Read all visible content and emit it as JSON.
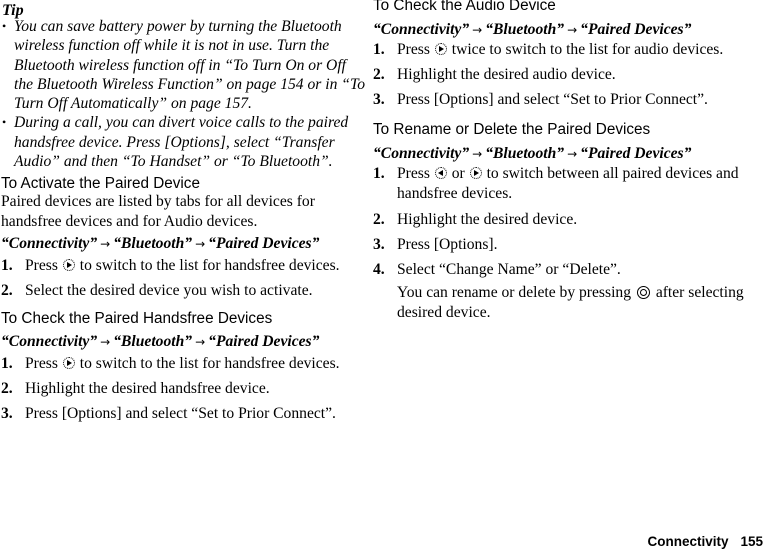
{
  "tip": {
    "title": "Tip",
    "bullet": "•",
    "items": [
      "You can save battery power by turning the Bluetooth wireless function off while it is not in use. Turn the Bluetooth wireless function off in “To Turn On or Off the Bluetooth Wireless Function” on page 154 or in “To Turn Off Automatically” on page 157.",
      "During a call, you can divert voice calls to the paired handsfree device. Press [Options], select “Transfer Audio” and then “To Handset” or “To Bluetooth”."
    ]
  },
  "path": {
    "part1": "“Connectivity”",
    "part2": "“Bluetooth”",
    "part3": "“Paired Devices”",
    "arrow": "→"
  },
  "sections": {
    "activate": {
      "heading": "To Activate the Paired Device",
      "intro": "Paired devices are listed by tabs for all devices for handsfree devices and for Audio devices.",
      "steps": [
        {
          "num": "1.",
          "pre": "Press",
          "post": "to switch to the list for handsfree devices."
        },
        {
          "num": "2.",
          "text": "Select the desired device you wish to activate."
        }
      ]
    },
    "check_handsfree": {
      "heading": "To Check the Paired Handsfree Devices",
      "steps": [
        {
          "num": "1.",
          "pre": "Press",
          "post": "to switch to the list for handsfree devices."
        },
        {
          "num": "2.",
          "text": "Highlight the desired handsfree device."
        },
        {
          "num": "3.",
          "text": "Press [Options] and select “Set to Prior Connect”."
        }
      ]
    },
    "check_audio": {
      "heading": "To Check the Audio Device",
      "steps": [
        {
          "num": "1.",
          "pre": "Press",
          "post": "twice to switch to the list for audio devices."
        },
        {
          "num": "2.",
          "text": "Highlight the desired audio device."
        },
        {
          "num": "3.",
          "text": "Press [Options] and select “Set to Prior Connect”."
        }
      ]
    },
    "rename_delete": {
      "heading": "To Rename or Delete the Paired Devices",
      "steps": [
        {
          "num": "1.",
          "pre": "Press",
          "mid": "or",
          "post": "to switch between all paired devices and handsfree devices."
        },
        {
          "num": "2.",
          "text": "Highlight the desired device."
        },
        {
          "num": "3.",
          "text": "Press [Options]."
        },
        {
          "num": "4.",
          "text": "Select “Change Name” or “Delete”."
        }
      ],
      "note_pre": "You can rename or delete by pressing",
      "note_post": "after selecting desired device."
    }
  },
  "icons": {
    "nav_right": "navigation-key-right",
    "nav_left": "navigation-key-left",
    "center": "center-select-key"
  },
  "footer": {
    "section": "Connectivity",
    "page": "155"
  }
}
